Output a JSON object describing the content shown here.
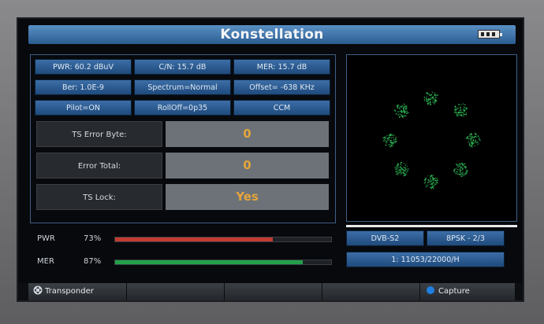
{
  "title": "Konstellation",
  "chips": {
    "pwr": "PWR: 60.2 dBuV",
    "cn": "C/N: 15.7 dB",
    "mer": "MER: 15.7 dB",
    "ber": "Ber: 1.0E-9",
    "spectrum": "Spectrum=Normal",
    "offset": "Offset= -638 KHz",
    "pilot": "Pilot=ON",
    "rolloff": "RollOff=0p35",
    "ccm": "CCM"
  },
  "status_rows": [
    {
      "label": "TS Error Byte:",
      "value": "0"
    },
    {
      "label": "Error Total:",
      "value": "0"
    },
    {
      "label": "TS Lock:",
      "value": "Yes"
    }
  ],
  "meters": [
    {
      "label": "PWR",
      "percent_text": "73%",
      "level": 0.73,
      "color": "#c23a30"
    },
    {
      "label": "MER",
      "percent_text": "87%",
      "level": 0.87,
      "color": "#23a04a"
    }
  ],
  "signal": {
    "standard": "DVB-S2",
    "modulation": "8PSK - 2/3",
    "transponder": "1: 11053/22000/H"
  },
  "softkeys": {
    "left": "Transponder",
    "right": "Capture"
  },
  "colors": {
    "accent": "#2b5d91",
    "value_text": "#e2a43c",
    "constellation_points": "#2fbf5a"
  },
  "icons": {
    "battery": "battery-icon",
    "left_key": "dpad-icon",
    "right_key": "blue-dot-icon"
  }
}
